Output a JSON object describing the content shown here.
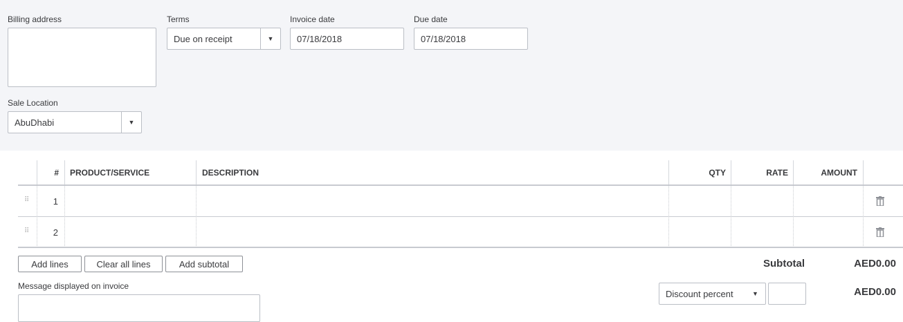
{
  "form": {
    "billing_address_label": "Billing address",
    "billing_address_value": "",
    "terms_label": "Terms",
    "terms_value": "Due on receipt",
    "invoice_date_label": "Invoice date",
    "invoice_date_value": "07/18/2018",
    "due_date_label": "Due date",
    "due_date_value": "07/18/2018",
    "sale_location_label": "Sale Location",
    "sale_location_value": "AbuDhabi"
  },
  "table": {
    "headers": {
      "num": "#",
      "product": "PRODUCT/SERVICE",
      "description": "DESCRIPTION",
      "qty": "QTY",
      "rate": "RATE",
      "amount": "AMOUNT"
    },
    "rows": [
      {
        "num": "1"
      },
      {
        "num": "2"
      }
    ]
  },
  "actions": {
    "add_lines": "Add lines",
    "clear_all_lines": "Clear all lines",
    "add_subtotal": "Add subtotal"
  },
  "message_label": "Message displayed on invoice",
  "totals": {
    "subtotal_label": "Subtotal",
    "subtotal_value": "AED0.00",
    "discount_type": "Discount percent",
    "discount_value": "AED0.00"
  }
}
